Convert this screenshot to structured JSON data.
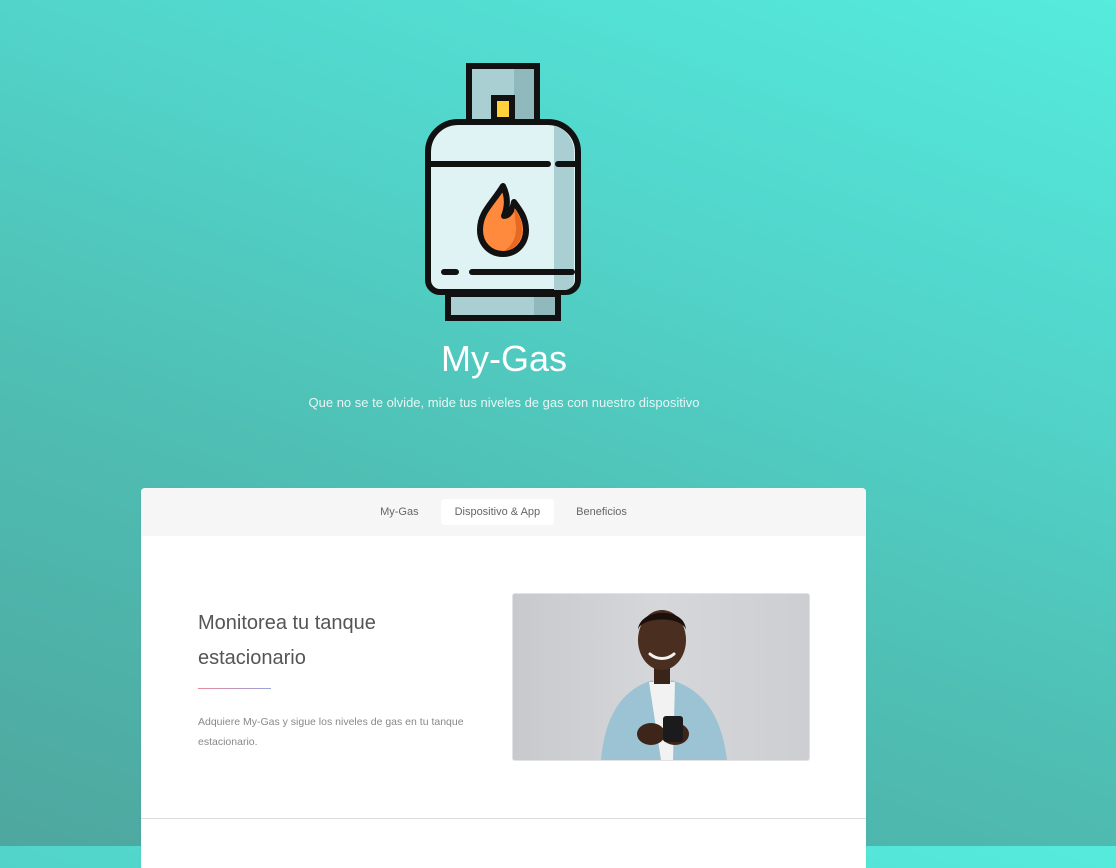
{
  "brand": {
    "title": "My-Gas",
    "subtitle": "Que no se te olvide, mide tus niveles de gas con nuestro dispositivo",
    "logo_icon": "gas-tank-icon"
  },
  "nav": {
    "tabs": [
      {
        "label": "My-Gas",
        "active": false
      },
      {
        "label": "Dispositivo & App",
        "active": true
      },
      {
        "label": "Beneficios",
        "active": false
      }
    ]
  },
  "section": {
    "heading": "Monitorea tu tanque estacionario",
    "text": "Adquiere My-Gas y sigue los niveles de gas en tu tanque estacionario.",
    "image_name": "man-with-phone-photo"
  },
  "colors": {
    "gradient_start": "#55ebdd",
    "gradient_end": "#4ea79f",
    "flame": "#ff8a3d",
    "tank_body": "#dff3f4"
  }
}
